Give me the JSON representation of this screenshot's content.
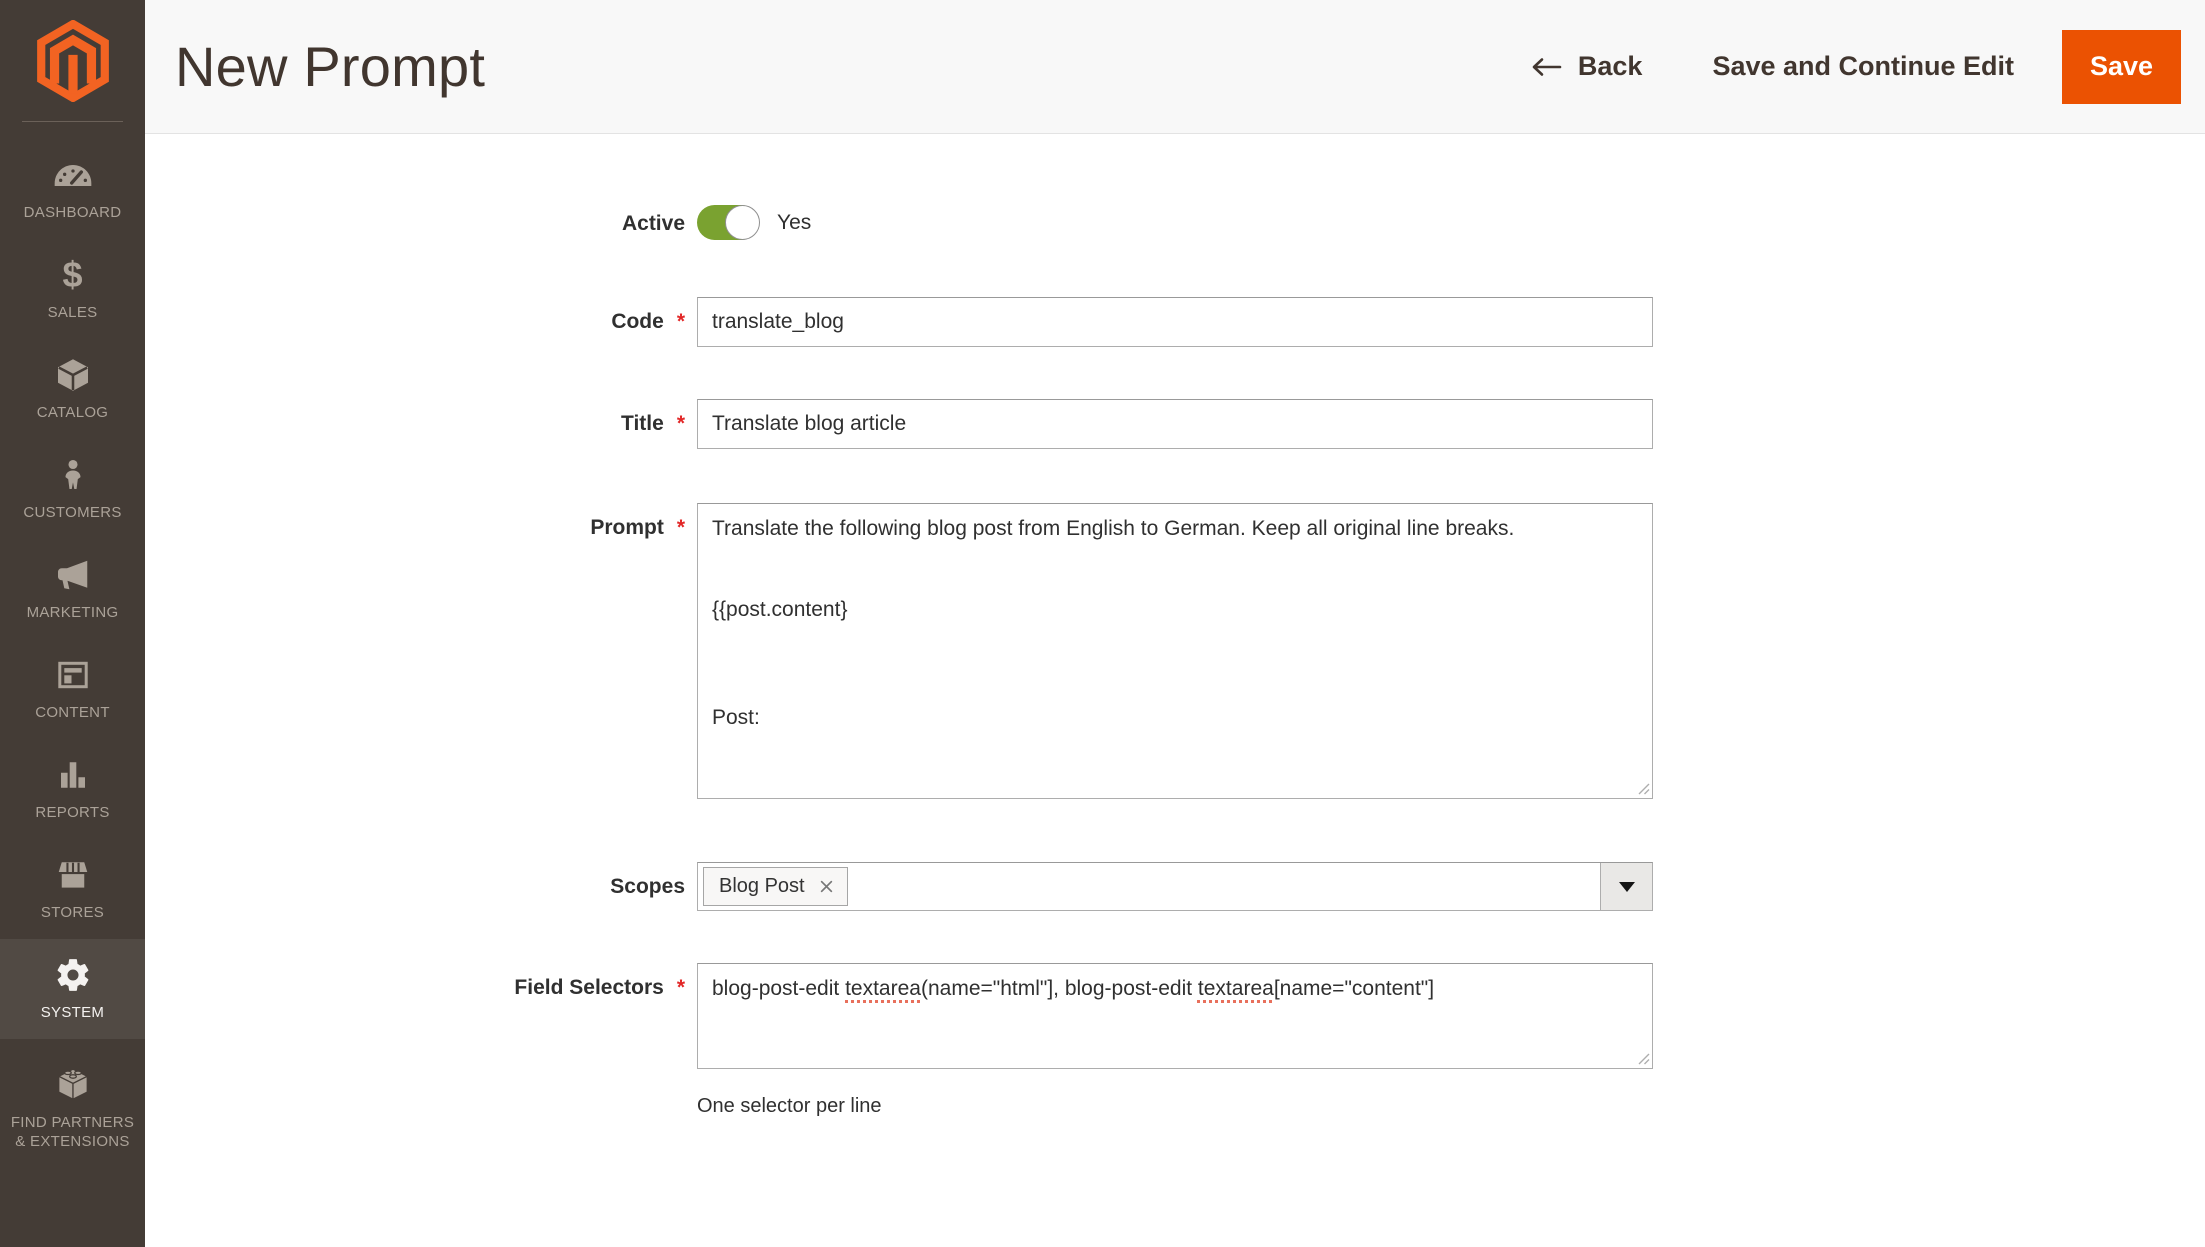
{
  "sidebar": {
    "items": [
      {
        "label": "DASHBOARD",
        "icon": "gauge-icon"
      },
      {
        "label": "SALES",
        "icon": "dollar-icon"
      },
      {
        "label": "CATALOG",
        "icon": "box-icon"
      },
      {
        "label": "CUSTOMERS",
        "icon": "person-icon"
      },
      {
        "label": "MARKETING",
        "icon": "megaphone-icon"
      },
      {
        "label": "CONTENT",
        "icon": "layout-icon"
      },
      {
        "label": "REPORTS",
        "icon": "bar-chart-icon"
      },
      {
        "label": "STORES",
        "icon": "storefront-icon"
      },
      {
        "label": "SYSTEM",
        "icon": "gear-icon",
        "active": true
      },
      {
        "label": "FIND PARTNERS & EXTENSIONS",
        "icon": "brick-icon"
      }
    ]
  },
  "header": {
    "title": "New Prompt",
    "back_label": "Back",
    "save_continue_label": "Save and Continue Edit",
    "save_label": "Save"
  },
  "form": {
    "required_mark": "*",
    "active": {
      "label": "Active",
      "value": "Yes",
      "state": "on"
    },
    "code": {
      "label": "Code",
      "value": "translate_blog"
    },
    "title": {
      "label": "Title",
      "value": "Translate blog article"
    },
    "prompt": {
      "label": "Prompt",
      "value": "Translate the following blog post from English to German. Keep all original line breaks.\n\n\n{{post.content}\n\n\n\nPost:"
    },
    "scopes": {
      "label": "Scopes",
      "tags": [
        {
          "label": "Blog Post"
        }
      ]
    },
    "field_selectors": {
      "label": "Field Selectors",
      "parts": [
        {
          "text": "blog-post-edit "
        },
        {
          "text": "textarea",
          "misspelled": true
        },
        {
          "text": "(name=\"html\"], blog-post-edit "
        },
        {
          "text": "textarea",
          "misspelled": true
        },
        {
          "text": "[name=\"content\"]"
        }
      ],
      "note": "One selector per line"
    }
  },
  "colors": {
    "accent_orange": "#eb5202",
    "logo_orange": "#f26322",
    "toggle_on_green": "#7aa230",
    "required_red": "#e22626",
    "sidebar_bg": "#443c36",
    "sidebar_active_bg": "#514a44",
    "header_bg": "#f8f8f8"
  }
}
